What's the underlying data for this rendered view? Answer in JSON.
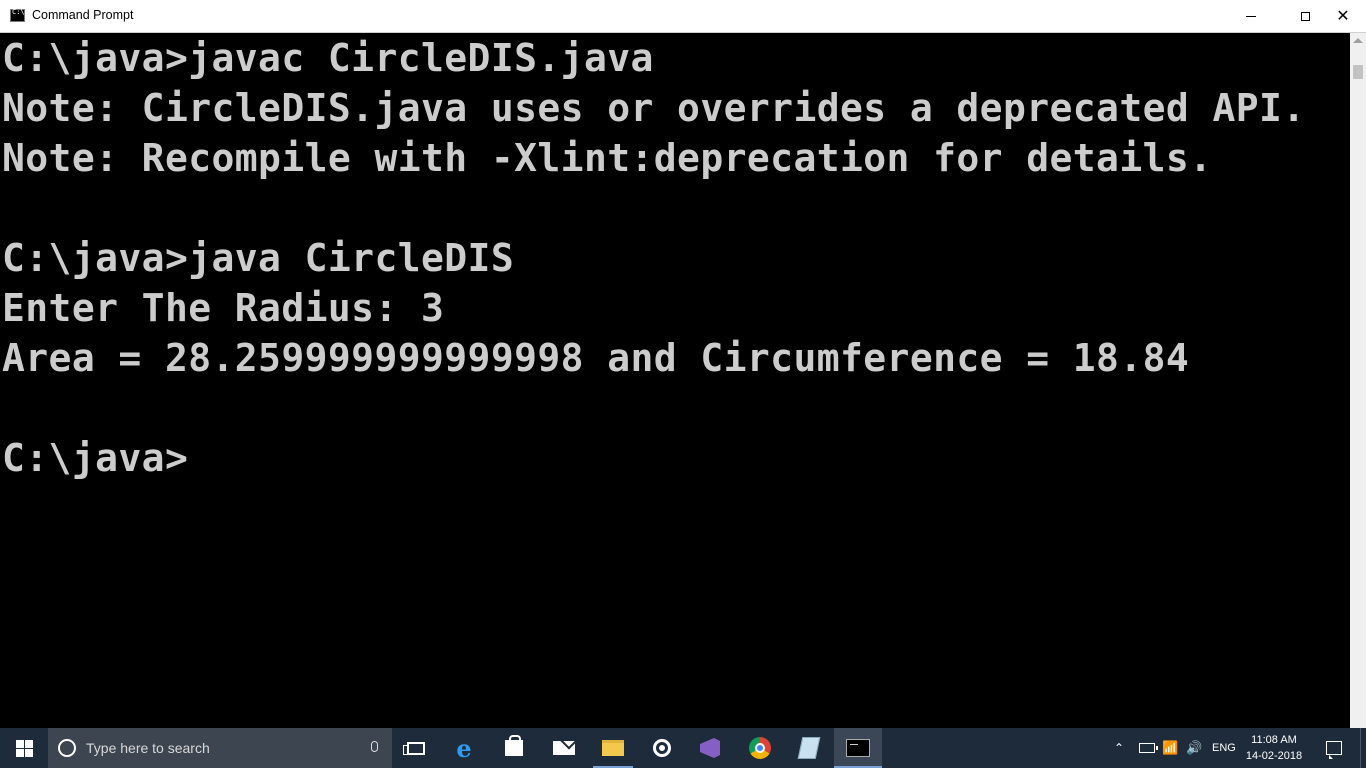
{
  "window": {
    "title": "Command Prompt",
    "icon": "cmd-icon",
    "controls": [
      "minimize",
      "maximize",
      "close"
    ]
  },
  "console": {
    "lines": [
      "C:\\java>javac CircleDIS.java",
      "Note: CircleDIS.java uses or overrides a deprecated API.",
      "Note: Recompile with -Xlint:deprecation for details.",
      "",
      "C:\\java>java CircleDIS",
      "Enter The Radius: 3",
      "Area = 28.259999999999998 and Circumference = 18.84",
      "",
      "C:\\java>"
    ],
    "text_color": "#cccccc",
    "background": "#000000"
  },
  "taskbar": {
    "search_placeholder": "Type here to search",
    "pinned_icons": [
      "task-view-icon",
      "edge-icon",
      "store-icon",
      "mail-icon",
      "file-explorer-icon",
      "groove-icon",
      "visual-studio-icon",
      "chrome-icon",
      "notes-icon",
      "command-prompt-icon"
    ],
    "tray": {
      "language": "ENG",
      "time": "11:08 AM",
      "date": "14-02-2018"
    },
    "background": "#1e2b3b"
  }
}
